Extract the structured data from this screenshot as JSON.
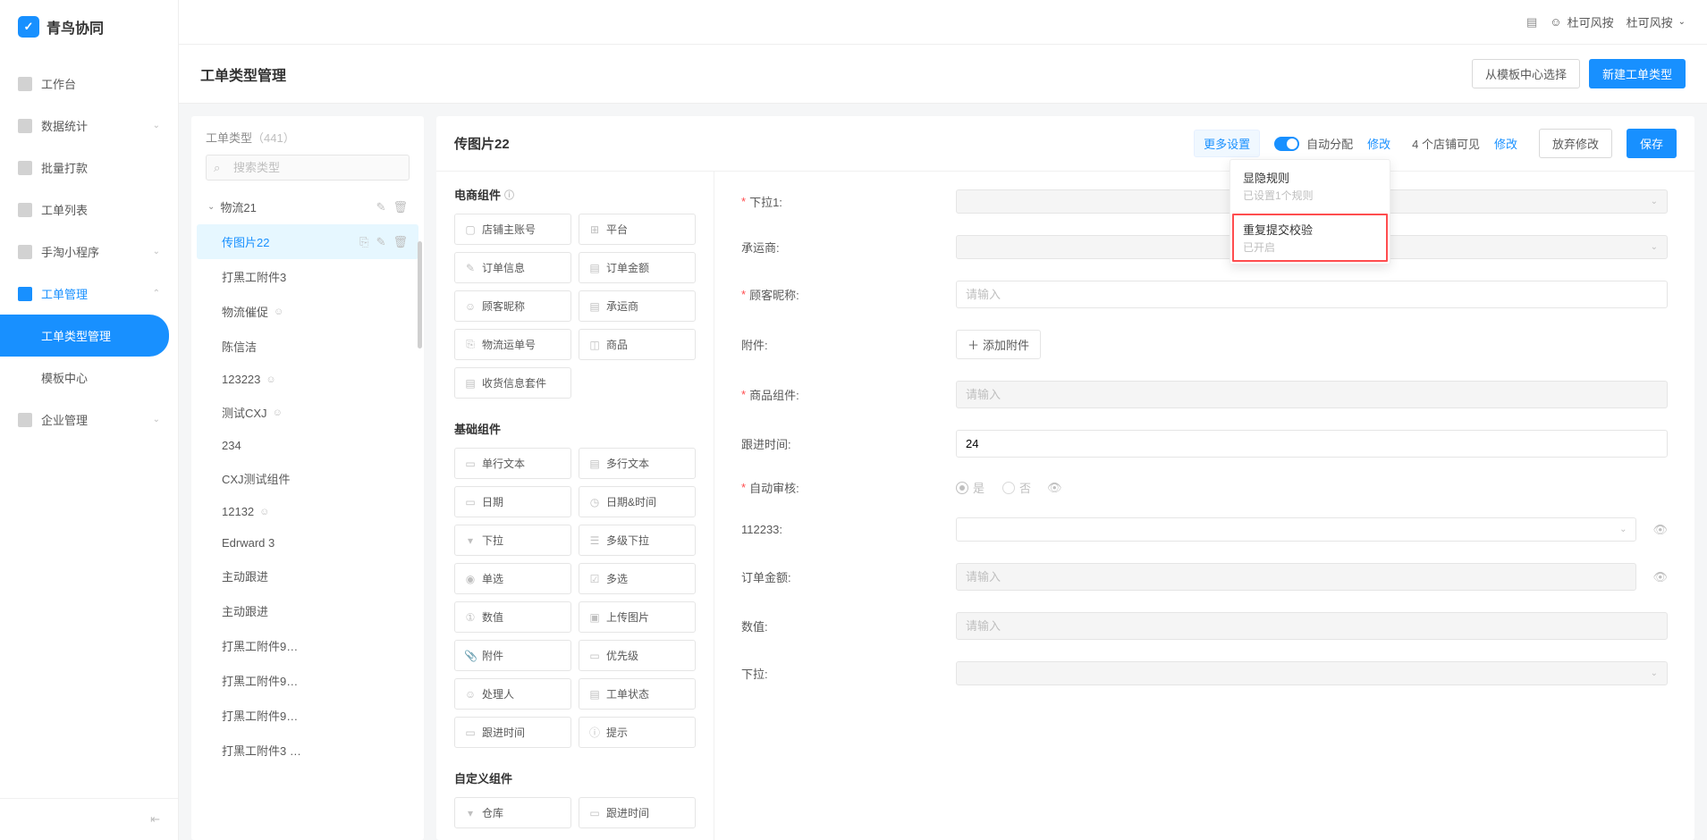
{
  "app_name": "青鸟协同",
  "topbar": {
    "user_name": "杜可风按",
    "org_name": "杜可风按"
  },
  "sidebar": {
    "items": [
      {
        "label": "工作台",
        "icon": "workbench"
      },
      {
        "label": "数据统计",
        "icon": "stats",
        "expandable": true
      },
      {
        "label": "批量打款",
        "icon": "payout"
      },
      {
        "label": "工单列表",
        "icon": "list"
      },
      {
        "label": "手淘小程序",
        "icon": "miniapp",
        "expandable": true
      },
      {
        "label": "工单管理",
        "icon": "manage",
        "expandable": true,
        "expanded": true,
        "active": true
      },
      {
        "label": "企业管理",
        "icon": "enterprise",
        "expandable": true
      }
    ],
    "sub_items": {
      "5": [
        {
          "label": "工单类型管理",
          "active": true
        },
        {
          "label": "模板中心"
        }
      ]
    }
  },
  "page": {
    "title": "工单类型管理",
    "actions": {
      "from_template": "从模板中心选择",
      "new_type": "新建工单类型"
    }
  },
  "type_panel": {
    "header": "工单类型",
    "count": "（441）",
    "search_placeholder": "搜索类型",
    "group": "物流21",
    "items": [
      {
        "label": "传图片22",
        "active": true,
        "actions": true
      },
      {
        "label": "打黑工附件3"
      },
      {
        "label": "物流催促",
        "person": true
      },
      {
        "label": "陈信洁"
      },
      {
        "label": "123223",
        "person": true
      },
      {
        "label": "测试CXJ",
        "person": true
      },
      {
        "label": "234"
      },
      {
        "label": "CXJ测试组件"
      },
      {
        "label": "12132",
        "person": true
      },
      {
        "label": "Edrward 3"
      },
      {
        "label": "主动跟进"
      },
      {
        "label": "主动跟进"
      },
      {
        "label": "打黑工附件9…"
      },
      {
        "label": "打黑工附件9…"
      },
      {
        "label": "打黑工附件9…"
      },
      {
        "label": "打黑工附件3 …"
      }
    ]
  },
  "editor": {
    "title": "传图片22",
    "toolbar": {
      "more_settings": "更多设置",
      "auto_assign": "自动分配",
      "modify": "修改",
      "shops_visible": "4 个店铺可见",
      "discard": "放弃修改",
      "save": "保存"
    },
    "dropdown": [
      {
        "title": "显隐规则",
        "sub": "已设置1个规则"
      },
      {
        "title": "重复提交校验",
        "sub": "已开启",
        "highlighted": true
      }
    ]
  },
  "palette": {
    "sections": [
      {
        "title": "电商组件",
        "info": true,
        "items": [
          {
            "label": "店铺主账号",
            "icon": "▢"
          },
          {
            "label": "平台",
            "icon": "⊞"
          },
          {
            "label": "订单信息",
            "icon": "✎"
          },
          {
            "label": "订单金额",
            "icon": "▤"
          },
          {
            "label": "顾客昵称",
            "icon": "☺"
          },
          {
            "label": "承运商",
            "icon": "▤"
          },
          {
            "label": "物流运单号",
            "icon": "⎘"
          },
          {
            "label": "商品",
            "icon": "◫"
          },
          {
            "label": "收货信息套件",
            "icon": "▤",
            "wide": true
          }
        ]
      },
      {
        "title": "基础组件",
        "items": [
          {
            "label": "单行文本",
            "icon": "▭"
          },
          {
            "label": "多行文本",
            "icon": "▤"
          },
          {
            "label": "日期",
            "icon": "▭"
          },
          {
            "label": "日期&时间",
            "icon": "◷"
          },
          {
            "label": "下拉",
            "icon": "▾"
          },
          {
            "label": "多级下拉",
            "icon": "☰"
          },
          {
            "label": "单选",
            "icon": "◉"
          },
          {
            "label": "多选",
            "icon": "☑"
          },
          {
            "label": "数值",
            "icon": "①"
          },
          {
            "label": "上传图片",
            "icon": "▣"
          },
          {
            "label": "附件",
            "icon": "📎"
          },
          {
            "label": "优先级",
            "icon": "▭"
          },
          {
            "label": "处理人",
            "icon": "☺"
          },
          {
            "label": "工单状态",
            "icon": "▤"
          },
          {
            "label": "跟进时间",
            "icon": "▭"
          },
          {
            "label": "提示",
            "icon": "ⓘ"
          }
        ]
      },
      {
        "title": "自定义组件",
        "items": [
          {
            "label": "仓库",
            "icon": "▾"
          },
          {
            "label": "跟进时间",
            "icon": "▭"
          }
        ]
      }
    ]
  },
  "form": {
    "rows": [
      {
        "label": "下拉1:",
        "required": true,
        "type": "select"
      },
      {
        "label": "承运商:",
        "type": "select"
      },
      {
        "label": "顾客昵称:",
        "required": true,
        "type": "input",
        "placeholder": "请输入"
      },
      {
        "label": "附件:",
        "type": "attach",
        "btn_label": "添加附件"
      },
      {
        "label": "商品组件:",
        "required": true,
        "type": "input",
        "placeholder": "请输入",
        "disabled": true
      },
      {
        "label": "跟进时间:",
        "type": "input",
        "value": "24"
      },
      {
        "label": "自动审核:",
        "required": true,
        "type": "radio",
        "options": [
          "是",
          "否"
        ],
        "eye": true
      },
      {
        "label": "112233:",
        "type": "select",
        "white": true,
        "eye": true
      },
      {
        "label": "订单金额:",
        "type": "input",
        "placeholder": "请输入",
        "disabled": true,
        "eye": true
      },
      {
        "label": "数值:",
        "type": "input",
        "placeholder": "请输入",
        "disabled": true
      },
      {
        "label": "下拉:",
        "type": "select"
      }
    ]
  }
}
